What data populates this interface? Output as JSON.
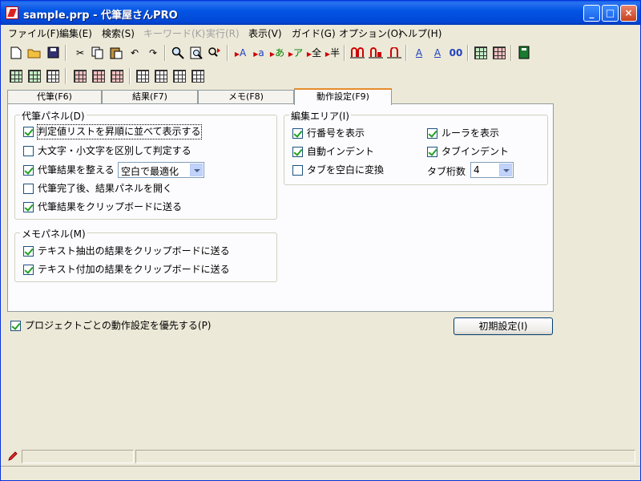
{
  "window": {
    "title": "sample.prp - 代筆屋さんPRO"
  },
  "title_buttons": {
    "minimize": "_",
    "maximize": "□",
    "close": "×"
  },
  "menu": [
    {
      "label": "ファイル(F)",
      "enabled": true
    },
    {
      "label": "編集(E)",
      "enabled": true
    },
    {
      "label": "検索(S)",
      "enabled": true
    },
    {
      "label": "キーワード(K)",
      "enabled": false
    },
    {
      "label": "実行(R)",
      "enabled": false
    },
    {
      "label": "表示(V)",
      "enabled": true
    },
    {
      "label": "ガイド(G)",
      "enabled": true
    },
    {
      "label": "オプション(O)",
      "enabled": true
    },
    {
      "label": "ヘルプ(H)",
      "enabled": true
    }
  ],
  "toolbar1": {
    "text_a1": "A",
    "text_a2": "a",
    "text_a3": "あ",
    "text_a4": "ア",
    "text_a5": "全",
    "text_a6": "半",
    "text_b1": "A",
    "text_b2": "A",
    "text_b3": "00"
  },
  "tabs": [
    {
      "label": "代筆(F6)"
    },
    {
      "label": "結果(F7)"
    },
    {
      "label": "メモ(F8)"
    },
    {
      "label": "動作設定(F9)"
    }
  ],
  "panel_daihitsu": {
    "title": "代筆パネル(D)",
    "options": [
      {
        "label": "判定値リストを昇順に並べて表示する",
        "checked": true
      },
      {
        "label": "大文字・小文字を区別して判定する",
        "checked": false
      },
      {
        "label": "代筆結果を整える",
        "checked": true
      },
      {
        "label": "代筆完了後、結果パネルを開く",
        "checked": false
      },
      {
        "label": "代筆結果をクリップボードに送る",
        "checked": true
      }
    ],
    "format_select": "空白で最適化"
  },
  "panel_memo": {
    "title": "メモパネル(M)",
    "options": [
      {
        "label": "テキスト抽出の結果をクリップボードに送る",
        "checked": true
      },
      {
        "label": "テキスト付加の結果をクリップボードに送る",
        "checked": true
      }
    ]
  },
  "panel_edit": {
    "title": "編集エリア(I)",
    "options": [
      {
        "label": "行番号を表示",
        "checked": true
      },
      {
        "label": "ルーラを表示",
        "checked": true
      },
      {
        "label": "自動インデント",
        "checked": true
      },
      {
        "label": "タブインデント",
        "checked": true
      },
      {
        "label": "タブを空白に変換",
        "checked": false
      }
    ],
    "tab_width_label": "タブ桁数",
    "tab_width_value": "4"
  },
  "project_priority": {
    "label": "プロジェクトごとの動作設定を優先する(P)",
    "checked": true
  },
  "reset_button": "初期設定(I)"
}
